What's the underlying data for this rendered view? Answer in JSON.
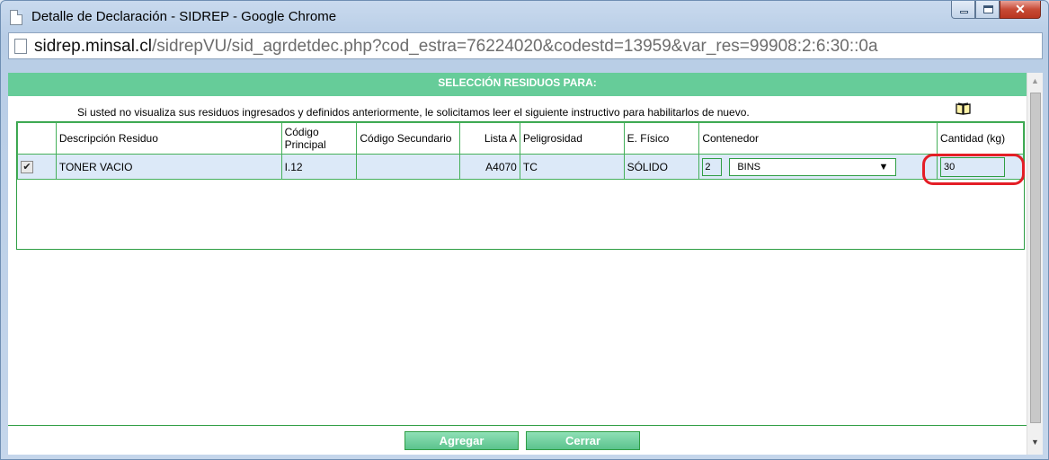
{
  "window": {
    "title": "Detalle de Declaración - SIDREP - Google Chrome"
  },
  "address": {
    "host": "sidrep.minsal.cl",
    "path": "/sidrepVU/sid_agrdetdec.php?cod_estra=76224020&codestd=13959&var_res=99908:2:6:30::0a"
  },
  "page": {
    "header": "SELECCIÓN RESIDUOS PARA:",
    "info": "Si usted no visualiza sus residuos ingresados y definidos anteriormente, le solicitamos leer el siguiente instructivo para habilitarlos de nuevo."
  },
  "table": {
    "headers": {
      "descripcion": "Descripción Residuo",
      "codigo_principal": "Código Principal",
      "codigo_secundario": "Código Secundario",
      "lista_a": "Lista A",
      "peligrosidad": "Peligrosidad",
      "e_fisico": "E. Físico",
      "contenedor": "Contenedor",
      "cantidad": "Cantidad (kg)"
    },
    "rows": [
      {
        "checked": "✔",
        "descripcion": "TONER VACIO",
        "codigo_principal": "I.12",
        "codigo_secundario": "",
        "lista_a": "A4070",
        "peligrosidad": "TC",
        "e_fisico": "SÓLIDO",
        "contenedor_cantidad": "2",
        "contenedor_tipo": "BINS",
        "cantidad": "30"
      }
    ]
  },
  "buttons": {
    "agregar": "Agregar",
    "cerrar": "Cerrar"
  },
  "colors": {
    "accent_green": "#66cc99",
    "highlight_red": "#e41e26"
  }
}
